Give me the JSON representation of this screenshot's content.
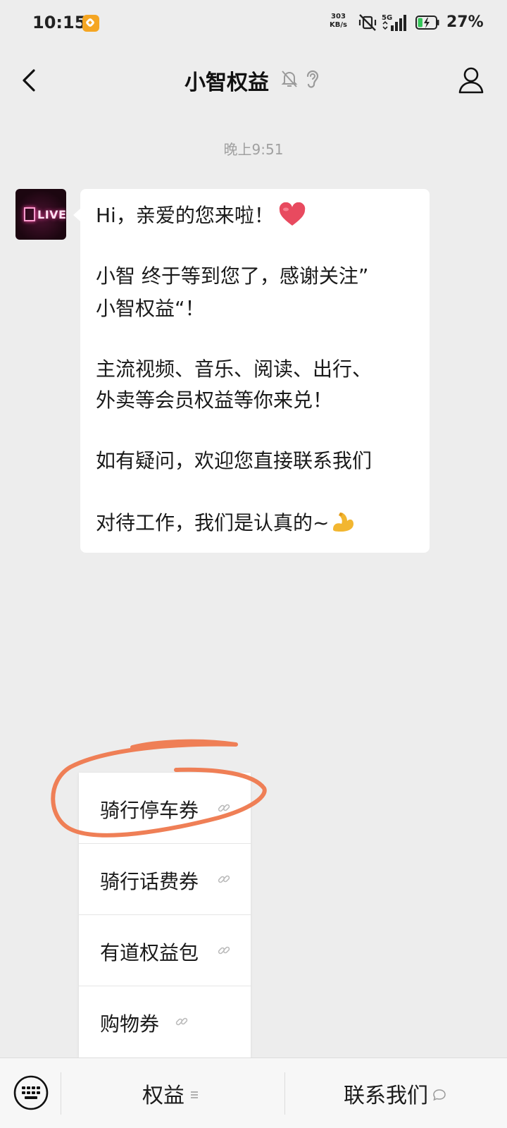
{
  "status_bar": {
    "time": "10:15",
    "net_speed_value": "303",
    "net_speed_unit": "KB/s",
    "network_type": "5G",
    "battery_percent": "27%",
    "battery_level": 0.27
  },
  "nav": {
    "title": "小智权益",
    "icons": [
      "back-icon",
      "bell-off-icon",
      "ear-icon",
      "profile-icon"
    ]
  },
  "chat": {
    "timestamp": "晚上9:51",
    "avatar_logo": "LIVE",
    "message_lines": [
      "Hi，亲爱的您来啦！",
      "小智  终于等到您了，感谢关注”",
      "小智权益“！",
      "主流视频、音乐、阅读、出行、",
      "外卖等会员权益等你来兑！",
      "如有疑问，欢迎您直接联系我们",
      "对待工作，我们是认真的~"
    ],
    "emojis": [
      "heart-icon",
      "muscle-icon"
    ]
  },
  "popup_menu": {
    "items": [
      {
        "label": "骑行停车券",
        "icon": "link-icon",
        "highlighted": true
      },
      {
        "label": "骑行话费券",
        "icon": "link-icon"
      },
      {
        "label": "有道权益包",
        "icon": "link-icon"
      },
      {
        "label": "购物券",
        "icon": "link-icon"
      }
    ]
  },
  "bottom_bar": {
    "tabs": [
      {
        "label": "权益",
        "icon": "menu-lines-icon"
      },
      {
        "label": "联系我们",
        "icon": "comment-icon"
      }
    ]
  },
  "colors": {
    "background": "#ededed",
    "bubble": "#ffffff",
    "annotation": "#ef7f56",
    "heart": "#e84a5f"
  }
}
